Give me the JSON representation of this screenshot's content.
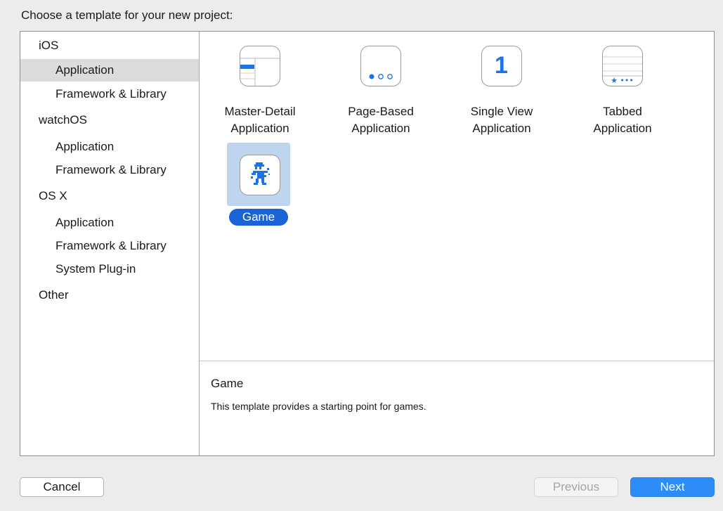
{
  "heading": "Choose a template for your new project:",
  "sidebar": {
    "items": [
      {
        "label": "iOS",
        "kind": "cat",
        "selected": false
      },
      {
        "label": "Application",
        "kind": "sub",
        "selected": true
      },
      {
        "label": "Framework & Library",
        "kind": "sub",
        "selected": false
      },
      {
        "label": "watchOS",
        "kind": "cat",
        "selected": false
      },
      {
        "label": "Application",
        "kind": "sub",
        "selected": false
      },
      {
        "label": "Framework & Library",
        "kind": "sub",
        "selected": false
      },
      {
        "label": "OS X",
        "kind": "cat",
        "selected": false
      },
      {
        "label": "Application",
        "kind": "sub",
        "selected": false
      },
      {
        "label": "Framework & Library",
        "kind": "sub",
        "selected": false
      },
      {
        "label": "System Plug-in",
        "kind": "sub",
        "selected": false
      },
      {
        "label": "Other",
        "kind": "cat",
        "selected": false
      }
    ]
  },
  "templates": [
    {
      "label_line1": "Master-Detail",
      "label_line2": "Application",
      "icon": "master-detail-icon"
    },
    {
      "label_line1": "Page-Based",
      "label_line2": "Application",
      "icon": "page-based-icon"
    },
    {
      "label_line1": "Single View",
      "label_line2": "Application",
      "icon": "single-view-icon",
      "icon_text": "1"
    },
    {
      "label_line1": "Tabbed",
      "label_line2": "Application",
      "icon": "tabbed-icon",
      "icon_text": "★ •••"
    },
    {
      "label_line1": "Game",
      "label_line2": "",
      "icon": "game-icon",
      "selected": true
    }
  ],
  "description": {
    "title": "Game",
    "text": "This template provides a starting point for games."
  },
  "buttons": {
    "cancel": "Cancel",
    "previous": "Previous",
    "next": "Next"
  },
  "colors": {
    "accent": "#1a63d6",
    "next_button": "#2d8cf7",
    "selection_highlight": "#bed4ef",
    "sidebar_selection": "#dcdcdc",
    "icon_blue": "#1a73e8"
  }
}
